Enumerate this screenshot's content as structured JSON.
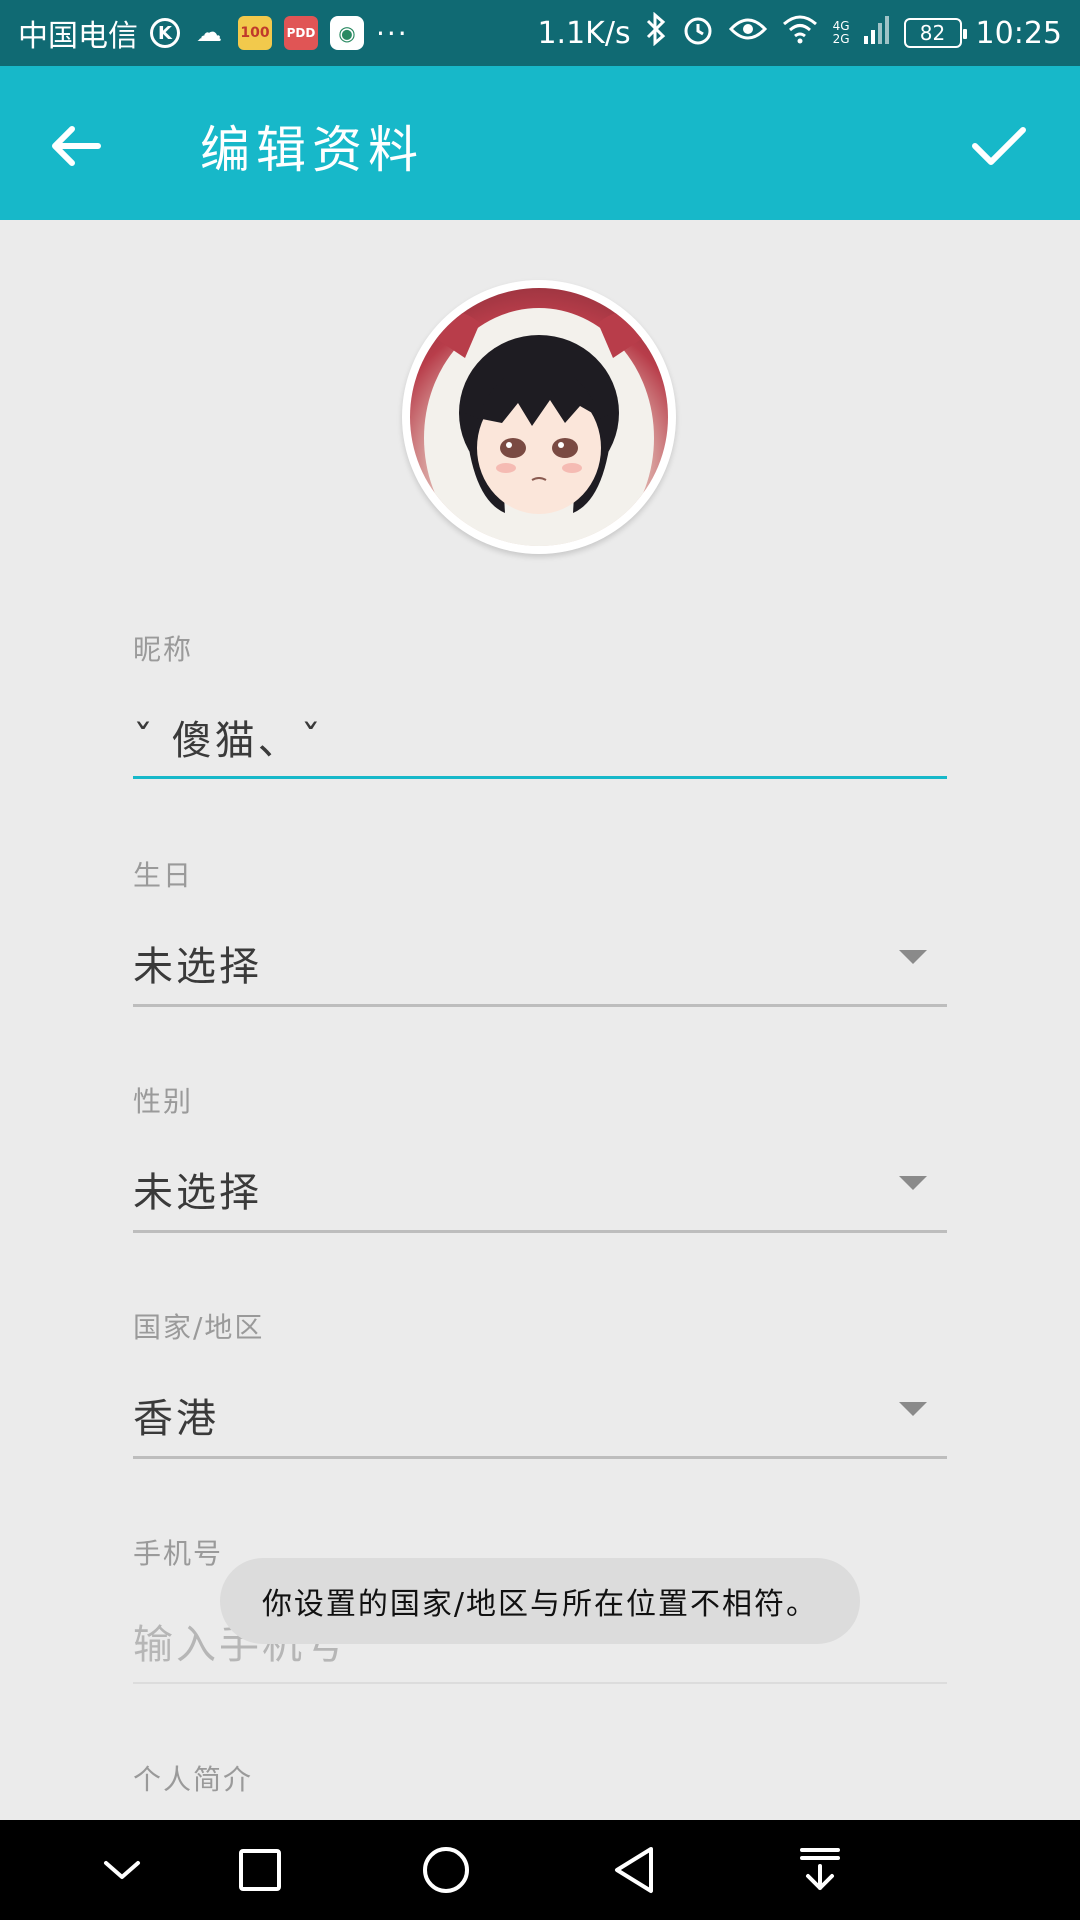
{
  "status_bar": {
    "carrier": "中国电信",
    "k_icon": "K",
    "app_icon_1": "100",
    "app_icon_2": "PDD",
    "overflow": "···",
    "speed": "1.1K/s",
    "network": "4G\n2G",
    "battery": "82",
    "time": "10:25"
  },
  "app_bar": {
    "title": "编辑资料"
  },
  "form": {
    "nickname": {
      "label": "昵称",
      "value": "ˇ 傻猫、ˇ"
    },
    "birthday": {
      "label": "生日",
      "value": "未选择"
    },
    "gender": {
      "label": "性别",
      "value": "未选择"
    },
    "region": {
      "label": "国家/地区",
      "value": "香港"
    },
    "phone": {
      "label": "手机号",
      "placeholder": "输入手机号"
    },
    "bio": {
      "label": "个人简介"
    }
  },
  "toast": {
    "message": "你设置的国家/地区与所在位置不相符。"
  },
  "colors": {
    "status_bar": "#106a73",
    "app_bar": "#17b8c9",
    "background": "#ebebeb",
    "accent": "#17b8c9"
  }
}
